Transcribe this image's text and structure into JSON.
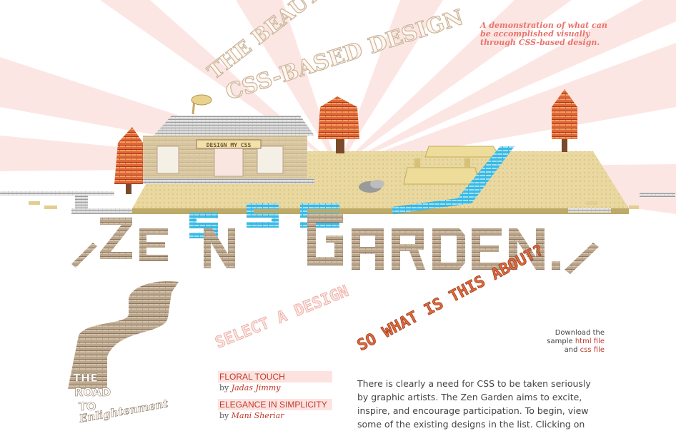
{
  "header": {
    "title_line1": "THE BEAUTY OF",
    "title_line2": "CSS-BASED DESIGN",
    "tagline_line1": "A demonstration of what can",
    "tagline_line2": "be accomplished visually",
    "tagline_line3": "through CSS-based design.",
    "logo_text": "ZEN CSS GARDEN.",
    "building_sign": "DESIGN MY CSS"
  },
  "side_art": {
    "road_text_1": "THE",
    "road_text_2": "ROAD",
    "road_text_3": "TO",
    "road_text_4": "Enlightenment"
  },
  "select_heading": "SELECT A DESIGN",
  "about_heading": "SO WHAT IS THIS ABOUT?",
  "download": {
    "prefix": "Download the sample",
    "html_link": "html file",
    "joiner": "and",
    "css_link": "css file"
  },
  "design_list": [
    {
      "name": "FLORAL TOUCH",
      "by": "by",
      "author": "Jadas Jimmy"
    },
    {
      "name": "ELEGANCE IN SIMPLICITY",
      "by": "by",
      "author": "Mani Sheriar"
    }
  ],
  "intro_text": "There is clearly a need for CSS to be taken seriously by graphic artists. The Zen Garden aims to excite, inspire, and encourage participation. To begin, view some of the existing designs in the list. Clicking on",
  "colors": {
    "accent": "#c0392b",
    "ray": "#fde8e6",
    "brick": "#b8a590",
    "water": "#35b6e0",
    "sand": "#e6d49a",
    "tree": "#d9552d"
  }
}
